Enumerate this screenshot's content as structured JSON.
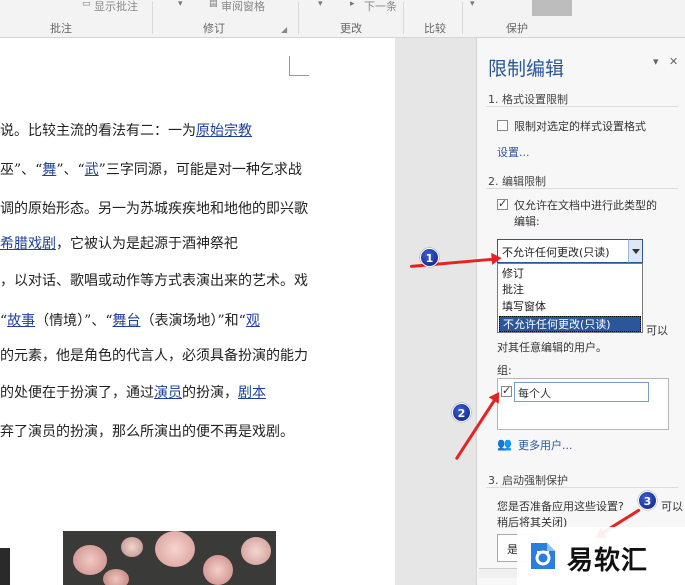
{
  "ribbon": {
    "commands": {
      "show_comments": "显示批注",
      "review_pane": "审阅窗格",
      "next": "下一条"
    },
    "groups": [
      "批注",
      "修订",
      "更改",
      "比较",
      "保护"
    ]
  },
  "document": {
    "lines": [
      [
        {
          "t": "说。比较主流的看法有二：一为"
        },
        {
          "t": "原始宗教",
          "link": true
        }
      ],
      [
        {
          "t": "巫"
        },
        {
          "t": "”、“"
        },
        {
          "t": "舞",
          "link": true
        },
        {
          "t": "”、“"
        },
        {
          "t": "武",
          "link": true
        },
        {
          "t": "”三字同源，可能是对一种乞求战"
        }
      ],
      [
        {
          "t": "调的原始形态。另一为苏城疾疾地和"
        },
        {
          "t": "地"
        },
        {
          "t": "他的即兴歌"
        }
      ],
      [
        {
          "t": "希腊戏剧",
          "link": true
        },
        {
          "t": "，它被认为是起源于酒神祭祀"
        }
      ],
      [
        {
          "t": "，以对话、歌唱或动作等方式表演出来的艺术。戏"
        }
      ],
      [
        {
          "t": "“"
        },
        {
          "t": "故事",
          "link": true
        },
        {
          "t": "（情境）”、“"
        },
        {
          "t": "舞台",
          "link": true
        },
        {
          "t": "（表演场地）”和“"
        },
        {
          "t": "观",
          "link": true
        }
      ],
      [
        {
          "t": "的元素，他是角色的代言人，必须具备扮演的能力"
        }
      ],
      [
        {
          "t": "的处便在于扮演了，通过"
        },
        {
          "t": "演员",
          "link": true
        },
        {
          "t": "的扮演，"
        },
        {
          "t": "剧本",
          "link": true
        }
      ],
      [
        {
          "t": "弃了演员的扮演，那么所演出的便不再是戏剧。"
        }
      ]
    ]
  },
  "panel": {
    "title": "限制编辑",
    "pin_symbol": "▾",
    "close_symbol": "✕",
    "section1": {
      "heading": "1. 格式设置限制",
      "checkbox_label": "限制对选定的样式设置格式",
      "settings_link": "设置..."
    },
    "section2": {
      "heading": "2. 编辑限制",
      "checkbox_label_line1": "仅允许在文档中进行此类型的",
      "checkbox_label_line2": "编辑:",
      "dropdown_value": "不允许任何更改(只读)",
      "options": [
        "修订",
        "批注",
        "填写窗体",
        "不允许任何更改(只读)"
      ],
      "exceptions_tail": "可以",
      "exceptions_line2": "对其任意编辑的用户。",
      "group_label": "组:",
      "group_everyone": "每个人",
      "more_users": "更多用户..."
    },
    "section3": {
      "heading": "3. 启动强制保护",
      "line1": "您是否准备应用这些设置?",
      "line1_tail": "可以",
      "line2": "稍后将其关闭)",
      "yes_button": "是"
    }
  },
  "annotations": [
    "1",
    "2",
    "3"
  ],
  "watermark": {
    "text": "易软汇"
  },
  "colors": {
    "accent": "#2b579a",
    "arrow": "#e52321",
    "link": "#1f3f9c"
  }
}
